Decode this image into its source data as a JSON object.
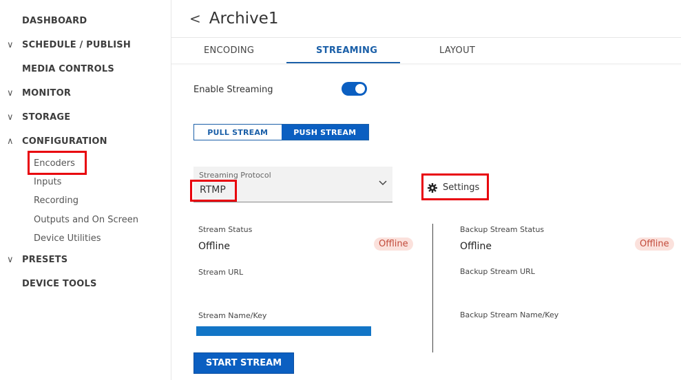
{
  "sidebar": {
    "dashboard": "DASHBOARD",
    "schedule_publish": "SCHEDULE / PUBLISH",
    "media_controls": "MEDIA CONTROLS",
    "monitor": "MONITOR",
    "storage": "STORAGE",
    "configuration": "CONFIGURATION",
    "configuration_items": [
      "Encoders",
      "Inputs",
      "Recording",
      "Outputs and On Screen",
      "Device Utilities"
    ],
    "presets": "PRESETS",
    "device_tools": "DEVICE TOOLS"
  },
  "header": {
    "back_glyph": "<",
    "title": "Archive1"
  },
  "tabs": [
    "ENCODING",
    "STREAMING",
    "LAYOUT"
  ],
  "active_tab": "STREAMING",
  "enable_streaming": {
    "label": "Enable Streaming",
    "on": true
  },
  "stream_mode": {
    "options": [
      "PULL STREAM",
      "PUSH STREAM"
    ],
    "selected": "PUSH STREAM"
  },
  "protocol": {
    "label": "Streaming Protocol",
    "value": "RTMP"
  },
  "settings_label": "Settings",
  "primary": {
    "status_label": "Stream Status",
    "status_value": "Offline",
    "badge": "Offline",
    "url_label": "Stream URL",
    "name_key_label": "Stream Name/Key",
    "name_key_fill": 1.0
  },
  "backup": {
    "status_label": "Backup Stream Status",
    "status_value": "Offline",
    "badge": "Offline",
    "url_label": "Backup Stream URL",
    "name_key_label": "Backup Stream Name/Key"
  },
  "start_button": "START STREAM",
  "colors": {
    "accent": "#0b5fc1",
    "highlight_box": "#e8000b",
    "offline_badge_bg": "#fbe1dc",
    "offline_badge_text": "#c24a3a"
  }
}
